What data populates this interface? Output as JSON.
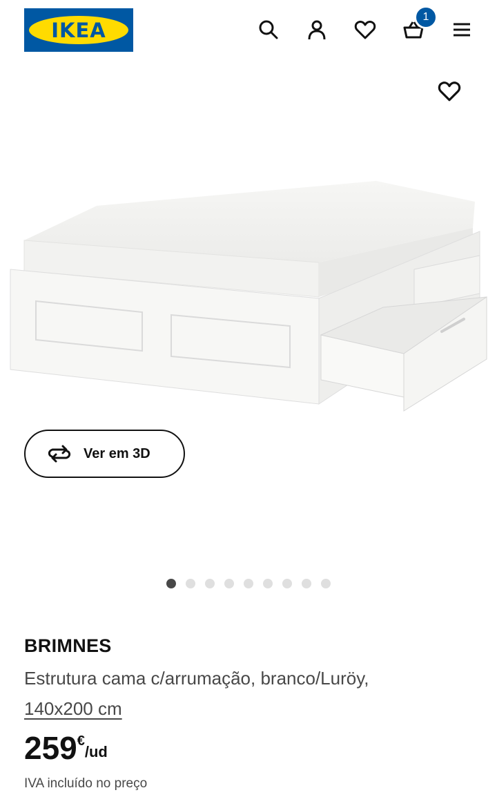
{
  "header": {
    "logo_text": "IKEA",
    "icons": [
      "search-icon",
      "user-icon",
      "heart-icon",
      "basket-icon",
      "menu-icon"
    ],
    "cart_count": "1"
  },
  "colors": {
    "brand_blue": "#0058a3",
    "brand_yellow": "#ffdb00",
    "text_primary": "#111111",
    "text_secondary": "#484848",
    "dot_active": "#484848",
    "dot_inactive": "#dfdfdf"
  },
  "gallery": {
    "view_3d_label": "Ver em 3D",
    "image_count": 9,
    "active_index": 0
  },
  "product": {
    "name": "BRIMNES",
    "description": "Estrutura cama c/arrumação, branco/Luröy,",
    "size_link": "140x200 cm",
    "price_amount": "259",
    "price_currency": "€",
    "price_unit": "/ud",
    "vat_note": "IVA incluído no preço"
  }
}
